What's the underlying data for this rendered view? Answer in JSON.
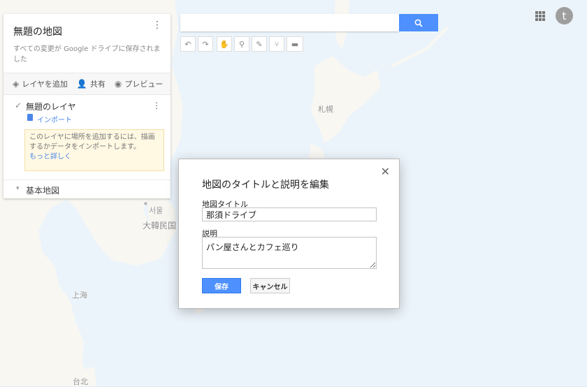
{
  "map": {
    "labels": {
      "sapporo": "札幌",
      "seoul": "서울",
      "korea": "大韓民国",
      "shanghai": "上海",
      "taipei": "台北"
    }
  },
  "panel": {
    "title": "無題の地図",
    "saved_notice": "すべての変更が Google ドライブに保存されました",
    "actions": {
      "add_layer": "レイヤを追加",
      "share": "共有",
      "preview": "プレビュー"
    },
    "layer": {
      "name": "無題のレイヤ",
      "import": "インポート",
      "hint": "このレイヤに場所を追加するには、描画するかデータをインポートします。",
      "learn_more": "もっと詳しく"
    },
    "base_map": "基本地図"
  },
  "search": {
    "value": "",
    "icon": "search-icon"
  },
  "toolbar": {
    "icons": [
      "undo-icon",
      "redo-icon",
      "hand-icon",
      "marker-icon",
      "draw-line-icon",
      "directions-icon",
      "ruler-icon"
    ]
  },
  "header": {
    "avatar_letter": "t"
  },
  "dialog": {
    "title": "地図のタイトルと説明を編集",
    "map_title_label": "地図タイトル",
    "map_title_value": "那須ドライブ",
    "description_label": "説明",
    "description_value": "パン屋さんとカフェ巡り",
    "save": "保存",
    "cancel": "キャンセル"
  },
  "colors": {
    "accent": "#4d90fe",
    "link": "#4a86e8",
    "hint_bg": "#fff8e3",
    "sea": "#dcebf7",
    "land": "#f4f1e8"
  }
}
